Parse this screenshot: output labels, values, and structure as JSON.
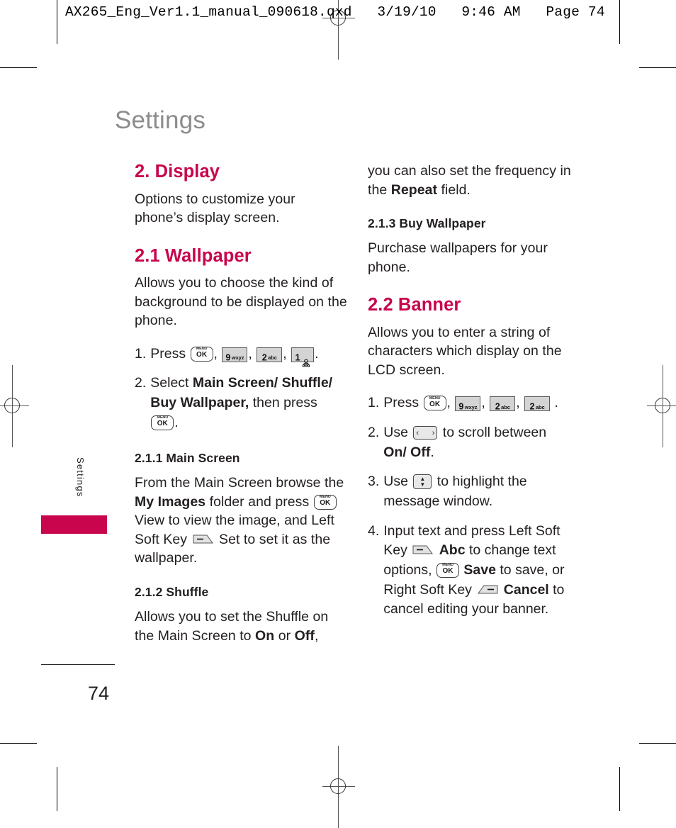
{
  "preflight": {
    "qxd_header": "AX265_Eng_Ver1.1_manual_090618.qxd   3/19/10   9:46 AM   Page 74"
  },
  "colors": {
    "accent": "#c8054d",
    "chapter_title": "#8c8c8c",
    "body_text": "#231f20"
  },
  "side_tab": {
    "label": "Settings"
  },
  "chapter": {
    "title": "Settings"
  },
  "footer": {
    "page_number": "74"
  },
  "left_column": {
    "section_heading": "2. Display",
    "intro": "Options to customize your phone’s display screen.",
    "wallpaper_heading": "2.1 Wallpaper",
    "wallpaper_intro": "Allows you to choose the kind of background to be displayed on the phone.",
    "step1": {
      "num": "1.",
      "lead": "Press",
      "keys": [
        "menu-ok",
        "9-wxyz",
        "2-abc",
        "1-voicemail"
      ],
      "trail": "."
    },
    "step2": {
      "num": "2.",
      "lead": "Select",
      "bold1": "Main Screen/ Shuffle/",
      "bold2": "Buy Wallpaper,",
      "mid": "then press",
      "trail": "."
    },
    "main_screen_heading": "2.1.1 Main Screen",
    "main_screen_body_a": "From the Main  Screen browse the",
    "main_screen_bold_a": "My Images",
    "main_screen_body_b": "folder and press",
    "main_screen_body_c": "View to view the image, and Left Soft Key",
    "main_screen_body_d": "Set to set it as the wallpaper.",
    "shuffle_heading": "2.1.2 Shuffle",
    "shuffle_body_a": "Allows you to set the Shuffle on the Main Screen to",
    "shuffle_bold_on": "On",
    "shuffle_body_or": "or",
    "shuffle_bold_off": "Off",
    "shuffle_body_end": ","
  },
  "right_column": {
    "cont_a": "you can also set the frequency in the",
    "cont_bold": "Repeat",
    "cont_b": "field.",
    "buy_wallpaper_heading": "2.1.3 Buy Wallpaper",
    "buy_wallpaper_body": "Purchase wallpapers for your phone.",
    "banner_heading": "2.2 Banner",
    "banner_intro": "Allows you to enter a string of characters which display on the LCD screen.",
    "step1": {
      "num": "1.",
      "lead": "Press",
      "keys": [
        "menu-ok",
        "9-wxyz",
        "2-abc",
        "2-abc"
      ],
      "trail": "."
    },
    "step2": {
      "num": "2.",
      "lead": "Use",
      "mid": "to scroll between",
      "bold": "On/ Off",
      "trail": "."
    },
    "step3": {
      "num": "3.",
      "lead": "Use",
      "mid": "to highlight the message window."
    },
    "step4": {
      "num": "4.",
      "lead": "Input text and press Left Soft Key",
      "bold_abc": "Abc",
      "mid_a": "to change text options,",
      "bold_save": "Save",
      "mid_b": "to save, or Right Soft Key",
      "bold_cancel": "Cancel",
      "mid_c": "to cancel editing your banner."
    }
  },
  "keys": {
    "menu_ok": {
      "top": "MENU",
      "bottom": "OK"
    },
    "nine": {
      "digit": "9",
      "letters": "wxyz"
    },
    "two": {
      "digit": "2",
      "letters": "abc"
    },
    "one": {
      "digit": "1",
      "letters": ""
    }
  }
}
